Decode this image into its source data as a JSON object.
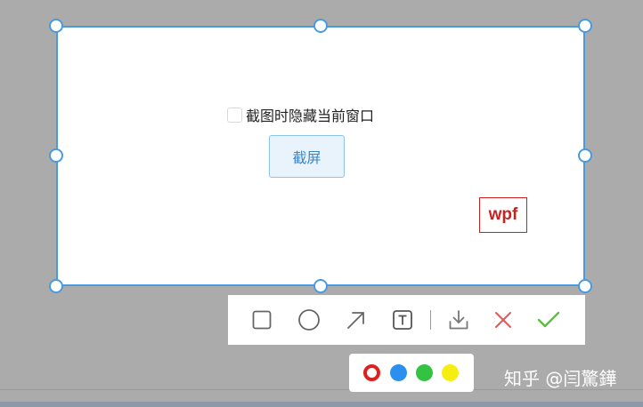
{
  "capture_panel": {
    "checkbox_label": "截图时隐藏当前窗口",
    "checkbox_checked": false,
    "capture_button_label": "截屏",
    "stamp_text": "wpf"
  },
  "toolbar": {
    "tools": [
      {
        "name": "rectangle",
        "icon": "square-icon"
      },
      {
        "name": "ellipse",
        "icon": "circle-icon"
      },
      {
        "name": "arrow",
        "icon": "arrow-icon"
      },
      {
        "name": "text",
        "icon": "text-icon",
        "glyph": "T"
      },
      {
        "name": "save",
        "icon": "download-icon"
      },
      {
        "name": "cancel",
        "icon": "close-icon"
      },
      {
        "name": "confirm",
        "icon": "check-icon"
      }
    ]
  },
  "colors": {
    "selection_border": "#4a9ae0",
    "swatches": [
      {
        "name": "red",
        "hex": "#e02020",
        "selected": true
      },
      {
        "name": "blue",
        "hex": "#2b8ff0",
        "selected": false
      },
      {
        "name": "green",
        "hex": "#33c241",
        "selected": false
      },
      {
        "name": "yellow",
        "hex": "#f5ee10",
        "selected": false
      }
    ]
  },
  "watermark": "知乎 @闫驚鏵"
}
